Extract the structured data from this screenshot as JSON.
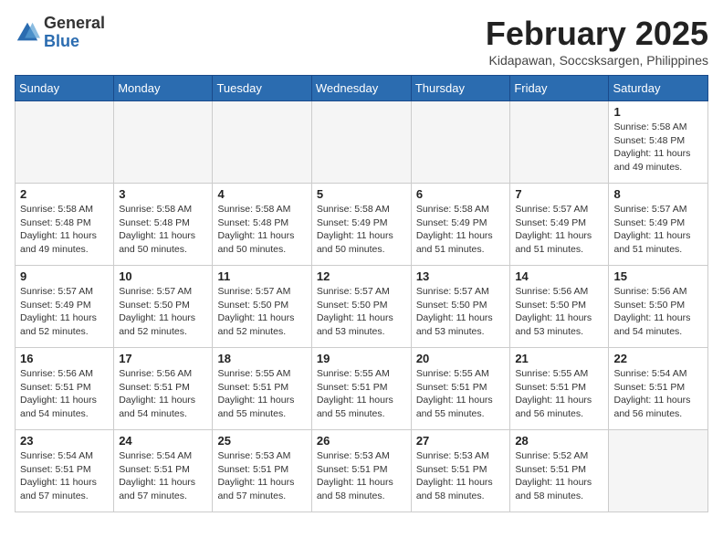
{
  "header": {
    "logo_line1": "General",
    "logo_line2": "Blue",
    "month": "February 2025",
    "location": "Kidapawan, Soccsksargen, Philippines"
  },
  "weekdays": [
    "Sunday",
    "Monday",
    "Tuesday",
    "Wednesday",
    "Thursday",
    "Friday",
    "Saturday"
  ],
  "weeks": [
    [
      {
        "day": "",
        "info": ""
      },
      {
        "day": "",
        "info": ""
      },
      {
        "day": "",
        "info": ""
      },
      {
        "day": "",
        "info": ""
      },
      {
        "day": "",
        "info": ""
      },
      {
        "day": "",
        "info": ""
      },
      {
        "day": "1",
        "info": "Sunrise: 5:58 AM\nSunset: 5:48 PM\nDaylight: 11 hours\nand 49 minutes."
      }
    ],
    [
      {
        "day": "2",
        "info": "Sunrise: 5:58 AM\nSunset: 5:48 PM\nDaylight: 11 hours\nand 49 minutes."
      },
      {
        "day": "3",
        "info": "Sunrise: 5:58 AM\nSunset: 5:48 PM\nDaylight: 11 hours\nand 50 minutes."
      },
      {
        "day": "4",
        "info": "Sunrise: 5:58 AM\nSunset: 5:48 PM\nDaylight: 11 hours\nand 50 minutes."
      },
      {
        "day": "5",
        "info": "Sunrise: 5:58 AM\nSunset: 5:49 PM\nDaylight: 11 hours\nand 50 minutes."
      },
      {
        "day": "6",
        "info": "Sunrise: 5:58 AM\nSunset: 5:49 PM\nDaylight: 11 hours\nand 51 minutes."
      },
      {
        "day": "7",
        "info": "Sunrise: 5:57 AM\nSunset: 5:49 PM\nDaylight: 11 hours\nand 51 minutes."
      },
      {
        "day": "8",
        "info": "Sunrise: 5:57 AM\nSunset: 5:49 PM\nDaylight: 11 hours\nand 51 minutes."
      }
    ],
    [
      {
        "day": "9",
        "info": "Sunrise: 5:57 AM\nSunset: 5:49 PM\nDaylight: 11 hours\nand 52 minutes."
      },
      {
        "day": "10",
        "info": "Sunrise: 5:57 AM\nSunset: 5:50 PM\nDaylight: 11 hours\nand 52 minutes."
      },
      {
        "day": "11",
        "info": "Sunrise: 5:57 AM\nSunset: 5:50 PM\nDaylight: 11 hours\nand 52 minutes."
      },
      {
        "day": "12",
        "info": "Sunrise: 5:57 AM\nSunset: 5:50 PM\nDaylight: 11 hours\nand 53 minutes."
      },
      {
        "day": "13",
        "info": "Sunrise: 5:57 AM\nSunset: 5:50 PM\nDaylight: 11 hours\nand 53 minutes."
      },
      {
        "day": "14",
        "info": "Sunrise: 5:56 AM\nSunset: 5:50 PM\nDaylight: 11 hours\nand 53 minutes."
      },
      {
        "day": "15",
        "info": "Sunrise: 5:56 AM\nSunset: 5:50 PM\nDaylight: 11 hours\nand 54 minutes."
      }
    ],
    [
      {
        "day": "16",
        "info": "Sunrise: 5:56 AM\nSunset: 5:51 PM\nDaylight: 11 hours\nand 54 minutes."
      },
      {
        "day": "17",
        "info": "Sunrise: 5:56 AM\nSunset: 5:51 PM\nDaylight: 11 hours\nand 54 minutes."
      },
      {
        "day": "18",
        "info": "Sunrise: 5:55 AM\nSunset: 5:51 PM\nDaylight: 11 hours\nand 55 minutes."
      },
      {
        "day": "19",
        "info": "Sunrise: 5:55 AM\nSunset: 5:51 PM\nDaylight: 11 hours\nand 55 minutes."
      },
      {
        "day": "20",
        "info": "Sunrise: 5:55 AM\nSunset: 5:51 PM\nDaylight: 11 hours\nand 55 minutes."
      },
      {
        "day": "21",
        "info": "Sunrise: 5:55 AM\nSunset: 5:51 PM\nDaylight: 11 hours\nand 56 minutes."
      },
      {
        "day": "22",
        "info": "Sunrise: 5:54 AM\nSunset: 5:51 PM\nDaylight: 11 hours\nand 56 minutes."
      }
    ],
    [
      {
        "day": "23",
        "info": "Sunrise: 5:54 AM\nSunset: 5:51 PM\nDaylight: 11 hours\nand 57 minutes."
      },
      {
        "day": "24",
        "info": "Sunrise: 5:54 AM\nSunset: 5:51 PM\nDaylight: 11 hours\nand 57 minutes."
      },
      {
        "day": "25",
        "info": "Sunrise: 5:53 AM\nSunset: 5:51 PM\nDaylight: 11 hours\nand 57 minutes."
      },
      {
        "day": "26",
        "info": "Sunrise: 5:53 AM\nSunset: 5:51 PM\nDaylight: 11 hours\nand 58 minutes."
      },
      {
        "day": "27",
        "info": "Sunrise: 5:53 AM\nSunset: 5:51 PM\nDaylight: 11 hours\nand 58 minutes."
      },
      {
        "day": "28",
        "info": "Sunrise: 5:52 AM\nSunset: 5:51 PM\nDaylight: 11 hours\nand 58 minutes."
      },
      {
        "day": "",
        "info": ""
      }
    ]
  ]
}
